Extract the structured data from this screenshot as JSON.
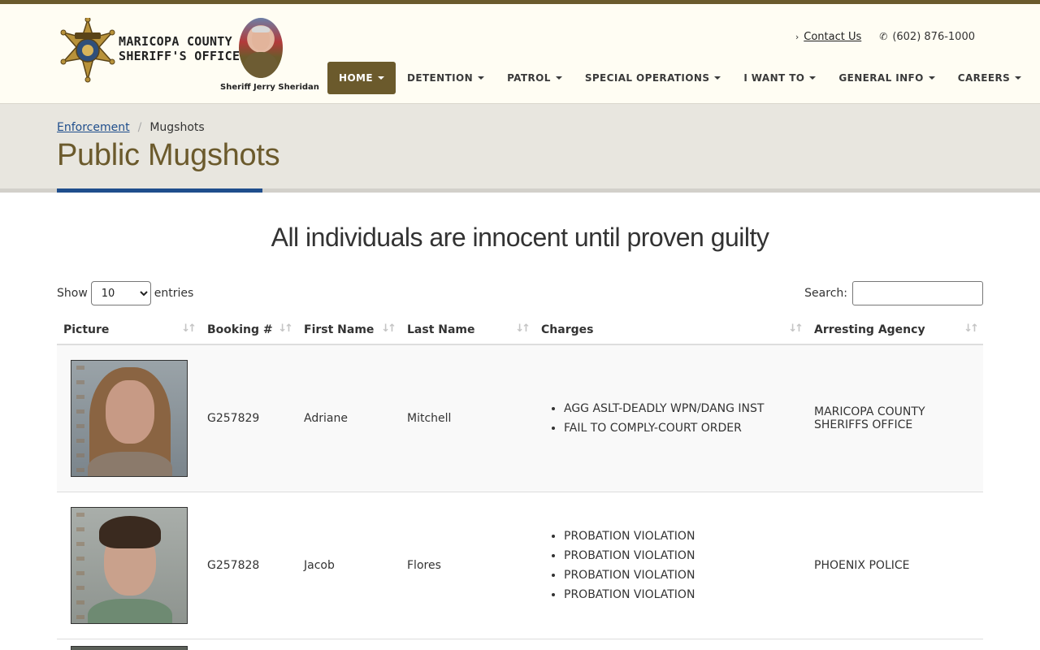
{
  "header": {
    "agency_line1": "MARICOPA COUNTY",
    "agency_line2": "SHERIFF'S OFFICE",
    "sheriff_caption": "Sheriff Jerry Sheridan",
    "badge_text": "SHERIFF",
    "contact_label": "Contact Us",
    "phone": "(602) 876-1000"
  },
  "nav": [
    {
      "label": "HOME",
      "active": true
    },
    {
      "label": "DETENTION"
    },
    {
      "label": "PATROL"
    },
    {
      "label": "SPECIAL OPERATIONS"
    },
    {
      "label": "I WANT TO"
    },
    {
      "label": "GENERAL INFO"
    },
    {
      "label": "CAREERS"
    }
  ],
  "breadcrumb": {
    "parent": "Enforcement",
    "current": "Mugshots"
  },
  "page_title": "Public Mugshots",
  "notice": "All individuals are innocent until proven guilty",
  "controls": {
    "show_label": "Show",
    "entries_label": "entries",
    "page_length": "10",
    "search_label": "Search:"
  },
  "table": {
    "columns": [
      "Picture",
      "Booking #",
      "First Name",
      "Last Name",
      "Charges",
      "Arresting Agency"
    ],
    "rows": [
      {
        "booking": "G257829",
        "first": "Adriane",
        "last": "Mitchell",
        "charges": [
          "AGG ASLT-DEADLY WPN/DANG INST",
          "FAIL TO COMPLY-COURT ORDER"
        ],
        "agency": "MARICOPA COUNTY SHERIFFS OFFICE"
      },
      {
        "booking": "G257828",
        "first": "Jacob",
        "last": "Flores",
        "charges": [
          "PROBATION VIOLATION",
          "PROBATION VIOLATION",
          "PROBATION VIOLATION",
          "PROBATION VIOLATION"
        ],
        "agency": "PHOENIX POLICE"
      }
    ]
  },
  "colors": {
    "brand_brown": "#6b5a2c",
    "link_blue": "#1f4e8c",
    "band_gray": "#e8e6df"
  }
}
